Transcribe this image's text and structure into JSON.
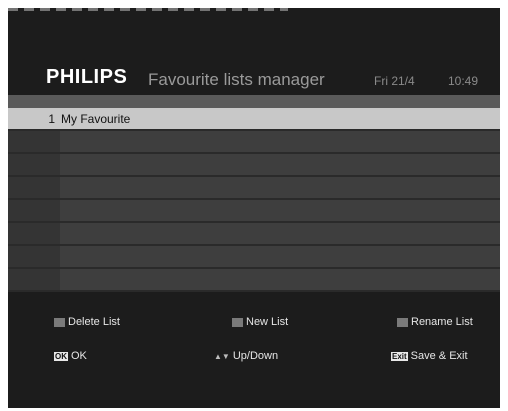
{
  "header": {
    "brand": "PHILIPS",
    "title": "Favourite lists manager",
    "date": "Fri 21/4",
    "time": "10:49"
  },
  "list": {
    "rows": [
      {
        "number": "1",
        "name": "My Favourite",
        "selected": true
      },
      {
        "number": "",
        "name": "",
        "selected": false
      },
      {
        "number": "",
        "name": "",
        "selected": false
      },
      {
        "number": "",
        "name": "",
        "selected": false
      },
      {
        "number": "",
        "name": "",
        "selected": false
      },
      {
        "number": "",
        "name": "",
        "selected": false
      },
      {
        "number": "",
        "name": "",
        "selected": false
      },
      {
        "number": "",
        "name": "",
        "selected": false
      }
    ]
  },
  "keys": {
    "delete_label": "Delete List",
    "new_label": "New List",
    "rename_label": "Rename List",
    "ok_tag": "OK",
    "ok_label": "OK",
    "updown_label": "Up/Down",
    "exit_tag": "Exit",
    "exit_label": "Save & Exit"
  },
  "colors": {
    "background": "#1c1c1c",
    "selected_row": "#c8c8c8",
    "row": "#3e3e3e",
    "brand": "#ffffff",
    "title": "#9a9a9a"
  },
  "icons": {
    "delete": "gray-key-icon",
    "new": "gray-key-icon",
    "rename": "gray-key-icon",
    "ok": "ok-key-icon",
    "updown": "up-down-arrows-icon",
    "exit": "exit-key-icon"
  }
}
